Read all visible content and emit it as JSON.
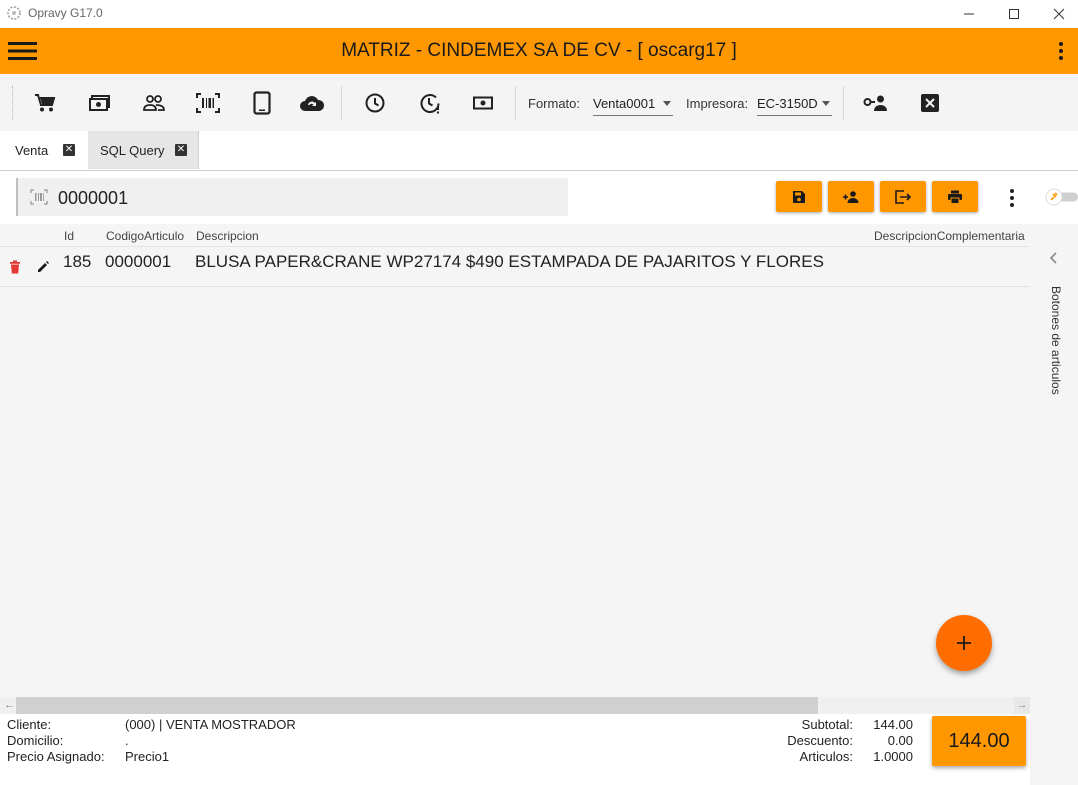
{
  "window": {
    "title": "Opravy G17.0",
    "controls": [
      "minimize-icon",
      "maximize-icon",
      "close-icon"
    ]
  },
  "appbar": {
    "title": "MATRIZ - CINDEMEX SA DE CV - [ oscarg17 ]",
    "menu_icon": "hamburger-menu-icon",
    "more_icon": "more-vert-icon",
    "color": "#ff9800"
  },
  "toolbar": {
    "icons": [
      "cart-icon",
      "cash-icon",
      "people-icon",
      "barcode-icon",
      "tablet-icon",
      "cloud-sync-icon",
      "clock-icon",
      "clock-alert-icon",
      "money-icon"
    ],
    "formato_label": "Formato:",
    "formato_value": "Venta0001",
    "impresora_label": "Impresora:",
    "impresora_value": "EC-3150D",
    "right_icons": [
      "user-key-icon",
      "close-box-icon"
    ]
  },
  "tabs": [
    {
      "label": "Venta",
      "active": true
    },
    {
      "label": "SQL Query",
      "active": false
    }
  ],
  "search": {
    "value": "0000001",
    "icon": "barcode-scan-icon"
  },
  "action_buttons": [
    "save-icon",
    "add-user-icon",
    "exit-icon",
    "print-icon"
  ],
  "table": {
    "columns": [
      "Id",
      "CodigoArticulo",
      "Descripcion",
      "DescripcionComplementaria"
    ],
    "rows": [
      {
        "id": "185",
        "codigo": "0000001",
        "descripcion": "BLUSA PAPER&CRANE WP27174 $490 ESTAMPADA DE PAJARITOS Y FLORES",
        "complementaria": ""
      }
    ]
  },
  "side_panel": {
    "label": "Botones de articulos"
  },
  "fab": {
    "icon": "plus-icon",
    "color": "#ff6d00"
  },
  "footer": {
    "cliente_label": "Cliente:",
    "cliente_value": "(000) | VENTA MOSTRADOR",
    "domicilio_label": "Domicilio:",
    "domicilio_value": ".",
    "precio_label": "Precio Asignado:",
    "precio_value": "Precio1",
    "subtotal_label": "Subtotal:",
    "subtotal_value": "144.00",
    "descuento_label": "Descuento:",
    "descuento_value": "0.00",
    "articulos_label": "Articulos:",
    "articulos_value": "1.0000",
    "total": "144.00"
  }
}
